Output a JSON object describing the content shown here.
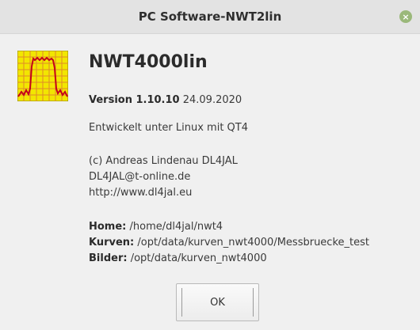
{
  "window": {
    "title": "PC Software-NWT2lin",
    "close_glyph": "×"
  },
  "about": {
    "app_name": "NWT4000lin",
    "version_label": "Version 1.10.10",
    "version_date": "24.09.2020",
    "developed_note": "Entwickelt unter Linux mit QT4",
    "copyright": "(c) Andreas Lindenau DL4JAL",
    "email": "DL4JAL@t-online.de",
    "website": "http://www.dl4jal.eu",
    "paths": [
      {
        "label": "Home:",
        "value": "/home/dl4jal/nwt4"
      },
      {
        "label": "Kurven:",
        "value": "/opt/data/kurven_nwt4000/Messbruecke_test"
      },
      {
        "label": "Bilder:",
        "value": "/opt/data/kurven_nwt4000"
      }
    ]
  },
  "buttons": {
    "ok_label": "OK"
  },
  "icon": {
    "name": "filter-curve-icon",
    "background": "#f2e600",
    "grid": "#e08a2a",
    "curve": "#c4001a"
  }
}
